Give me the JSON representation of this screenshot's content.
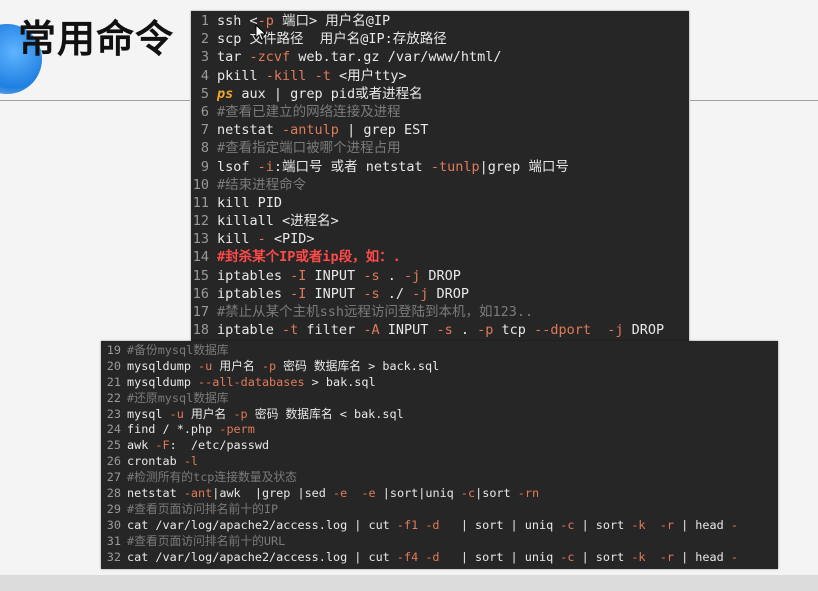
{
  "slide": {
    "title": "常用命令"
  },
  "colors": {
    "panel_bg": "#262626",
    "text": "#e8e8e8",
    "line_number": "#9a9a9a",
    "flag": "#e07a5a",
    "comment": "#7b7b7b",
    "keyword": "#f0a830",
    "warn": "#ff4a4a",
    "accent_blob": "#1f7fe0"
  },
  "icons": {
    "cursor": "mouse-pointer-icon"
  },
  "top_panel": {
    "lines": [
      {
        "num": "1",
        "segments": [
          {
            "t": "ssh <",
            "k": "plain"
          },
          {
            "t": "-p",
            "k": "flag"
          },
          {
            "t": " 端口> 用户名@IP",
            "k": "plain"
          }
        ]
      },
      {
        "num": "2",
        "segments": [
          {
            "t": "scp 文件路径  用户名@IP:存放路径",
            "k": "plain"
          }
        ]
      },
      {
        "num": "3",
        "segments": [
          {
            "t": "tar ",
            "k": "plain"
          },
          {
            "t": "-zcvf",
            "k": "flag"
          },
          {
            "t": " web.tar.gz /var/www/html/",
            "k": "plain"
          }
        ]
      },
      {
        "num": "4",
        "segments": [
          {
            "t": "pkill ",
            "k": "plain"
          },
          {
            "t": "-kill",
            "k": "flag"
          },
          {
            "t": " ",
            "k": "plain"
          },
          {
            "t": "-t",
            "k": "flag"
          },
          {
            "t": " <用户tty>",
            "k": "plain"
          }
        ]
      },
      {
        "num": "5",
        "segments": [
          {
            "t": "ps",
            "k": "keyword"
          },
          {
            "t": " aux | grep pid或者进程名",
            "k": "plain"
          }
        ]
      },
      {
        "num": "6",
        "segments": [
          {
            "t": "#查看已建立的网络连接及进程",
            "k": "comment"
          }
        ]
      },
      {
        "num": "7",
        "segments": [
          {
            "t": "netstat ",
            "k": "plain"
          },
          {
            "t": "-antulp",
            "k": "flag"
          },
          {
            "t": " | grep EST",
            "k": "plain"
          }
        ]
      },
      {
        "num": "8",
        "segments": [
          {
            "t": "#查看指定端口被哪个进程占用",
            "k": "comment"
          }
        ]
      },
      {
        "num": "9",
        "segments": [
          {
            "t": "lsof ",
            "k": "plain"
          },
          {
            "t": "-i",
            "k": "flag"
          },
          {
            "t": ":端口号 或者 netstat ",
            "k": "plain"
          },
          {
            "t": "-tunlp",
            "k": "flag"
          },
          {
            "t": "|grep 端口号",
            "k": "plain"
          }
        ]
      },
      {
        "num": "10",
        "segments": [
          {
            "t": "#结束进程命令",
            "k": "comment"
          }
        ]
      },
      {
        "num": "11",
        "segments": [
          {
            "t": "kill PID",
            "k": "plain"
          }
        ]
      },
      {
        "num": "12",
        "segments": [
          {
            "t": "killall <进程名>",
            "k": "plain"
          }
        ]
      },
      {
        "num": "13",
        "segments": [
          {
            "t": "kill ",
            "k": "plain"
          },
          {
            "t": "-",
            "k": "flag"
          },
          {
            "t": " <PID>",
            "k": "plain"
          }
        ]
      },
      {
        "num": "14",
        "segments": [
          {
            "t": "#封杀某个IP或者ip段，如：.",
            "k": "warn"
          }
        ]
      },
      {
        "num": "15",
        "segments": [
          {
            "t": "iptables ",
            "k": "plain"
          },
          {
            "t": "-I",
            "k": "flag"
          },
          {
            "t": " INPUT ",
            "k": "plain"
          },
          {
            "t": "-s",
            "k": "flag"
          },
          {
            "t": " . ",
            "k": "plain"
          },
          {
            "t": "-j",
            "k": "flag"
          },
          {
            "t": " DROP",
            "k": "plain"
          }
        ]
      },
      {
        "num": "16",
        "segments": [
          {
            "t": "iptables ",
            "k": "plain"
          },
          {
            "t": "-I",
            "k": "flag"
          },
          {
            "t": " INPUT ",
            "k": "plain"
          },
          {
            "t": "-s",
            "k": "flag"
          },
          {
            "t": " ./ ",
            "k": "plain"
          },
          {
            "t": "-j",
            "k": "flag"
          },
          {
            "t": " DROP",
            "k": "plain"
          }
        ]
      },
      {
        "num": "17",
        "segments": [
          {
            "t": "#禁止从某个主机ssh远程访问登陆到本机，如123..",
            "k": "comment"
          }
        ]
      },
      {
        "num": "18",
        "segments": [
          {
            "t": "iptable ",
            "k": "plain"
          },
          {
            "t": "-t",
            "k": "flag"
          },
          {
            "t": " filter ",
            "k": "plain"
          },
          {
            "t": "-A",
            "k": "flag"
          },
          {
            "t": " INPUT ",
            "k": "plain"
          },
          {
            "t": "-s",
            "k": "flag"
          },
          {
            "t": " . ",
            "k": "plain"
          },
          {
            "t": "-p",
            "k": "flag"
          },
          {
            "t": " tcp ",
            "k": "plain"
          },
          {
            "t": "--dport",
            "k": "flag"
          },
          {
            "t": "  ",
            "k": "plain"
          },
          {
            "t": "-j",
            "k": "flag"
          },
          {
            "t": " DROP",
            "k": "plain"
          }
        ]
      }
    ]
  },
  "bottom_panel": {
    "lines": [
      {
        "num": "19",
        "segments": [
          {
            "t": "#备份mysql数据库",
            "k": "comment"
          }
        ]
      },
      {
        "num": "20",
        "segments": [
          {
            "t": "mysqldump ",
            "k": "plain"
          },
          {
            "t": "-u",
            "k": "flag"
          },
          {
            "t": " 用户名 ",
            "k": "plain"
          },
          {
            "t": "-p",
            "k": "flag"
          },
          {
            "t": " 密码 数据库名 > back.sql",
            "k": "plain"
          }
        ]
      },
      {
        "num": "21",
        "segments": [
          {
            "t": "mysqldump ",
            "k": "plain"
          },
          {
            "t": "--all-databases",
            "k": "flag"
          },
          {
            "t": " > bak.sql",
            "k": "plain"
          }
        ]
      },
      {
        "num": "22",
        "segments": [
          {
            "t": "#还原mysql数据库",
            "k": "comment"
          }
        ]
      },
      {
        "num": "23",
        "segments": [
          {
            "t": "mysql ",
            "k": "plain"
          },
          {
            "t": "-u",
            "k": "flag"
          },
          {
            "t": " 用户名 ",
            "k": "plain"
          },
          {
            "t": "-p",
            "k": "flag"
          },
          {
            "t": " 密码 数据库名 < bak.sql",
            "k": "plain"
          }
        ]
      },
      {
        "num": "24",
        "segments": [
          {
            "t": "find / *.php ",
            "k": "plain"
          },
          {
            "t": "-perm",
            "k": "flag"
          }
        ]
      },
      {
        "num": "25",
        "segments": [
          {
            "t": "awk ",
            "k": "plain"
          },
          {
            "t": "-F",
            "k": "flag"
          },
          {
            "t": ":  /etc/passwd",
            "k": "plain"
          }
        ]
      },
      {
        "num": "26",
        "segments": [
          {
            "t": "crontab ",
            "k": "plain"
          },
          {
            "t": "-l",
            "k": "flag"
          }
        ]
      },
      {
        "num": "27",
        "segments": [
          {
            "t": "#检测所有的tcp连接数量及状态",
            "k": "comment"
          }
        ]
      },
      {
        "num": "28",
        "segments": [
          {
            "t": "netstat ",
            "k": "plain"
          },
          {
            "t": "-ant",
            "k": "flag"
          },
          {
            "t": "|awk  |grep |sed ",
            "k": "plain"
          },
          {
            "t": "-e",
            "k": "flag"
          },
          {
            "t": "  ",
            "k": "plain"
          },
          {
            "t": "-e",
            "k": "flag"
          },
          {
            "t": " |sort|uniq ",
            "k": "plain"
          },
          {
            "t": "-c",
            "k": "flag"
          },
          {
            "t": "|sort ",
            "k": "plain"
          },
          {
            "t": "-rn",
            "k": "flag"
          }
        ]
      },
      {
        "num": "29",
        "segments": [
          {
            "t": "#查看页面访问排名前十的IP",
            "k": "comment"
          }
        ]
      },
      {
        "num": "30",
        "segments": [
          {
            "t": "cat /var/log/apache2/access.log | cut ",
            "k": "plain"
          },
          {
            "t": "-f1",
            "k": "flag"
          },
          {
            "t": " ",
            "k": "plain"
          },
          {
            "t": "-d",
            "k": "flag"
          },
          {
            "t": "   | sort | uniq ",
            "k": "plain"
          },
          {
            "t": "-c",
            "k": "flag"
          },
          {
            "t": " | sort ",
            "k": "plain"
          },
          {
            "t": "-k",
            "k": "flag"
          },
          {
            "t": "  ",
            "k": "plain"
          },
          {
            "t": "-r",
            "k": "flag"
          },
          {
            "t": " | head ",
            "k": "plain"
          },
          {
            "t": "-",
            "k": "flag"
          }
        ]
      },
      {
        "num": "31",
        "segments": [
          {
            "t": "#查看页面访问排名前十的URL",
            "k": "comment"
          }
        ]
      },
      {
        "num": "32",
        "segments": [
          {
            "t": "cat /var/log/apache2/access.log | cut ",
            "k": "plain"
          },
          {
            "t": "-f4",
            "k": "flag"
          },
          {
            "t": " ",
            "k": "plain"
          },
          {
            "t": "-d",
            "k": "flag"
          },
          {
            "t": "   | sort | uniq ",
            "k": "plain"
          },
          {
            "t": "-c",
            "k": "flag"
          },
          {
            "t": " | sort ",
            "k": "plain"
          },
          {
            "t": "-k",
            "k": "flag"
          },
          {
            "t": "  ",
            "k": "plain"
          },
          {
            "t": "-r",
            "k": "flag"
          },
          {
            "t": " | head ",
            "k": "plain"
          },
          {
            "t": "-",
            "k": "flag"
          }
        ]
      }
    ]
  }
}
